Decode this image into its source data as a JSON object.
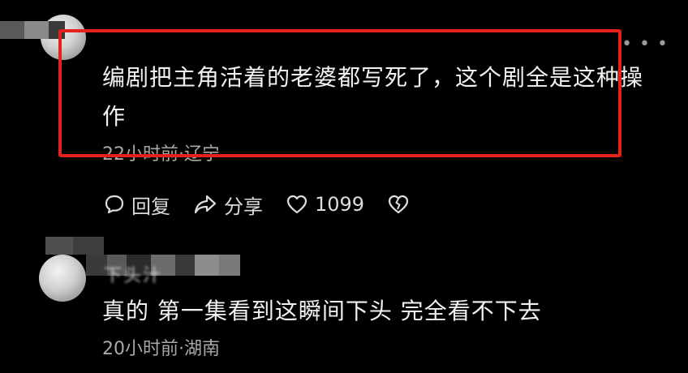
{
  "comments": [
    {
      "text": "编剧把主角活着的老婆都写死了，这个剧全是这种操作",
      "time_location": "22小时前·辽宁",
      "actions": {
        "reply_label": "回复",
        "share_label": "分享",
        "like_count": "1099"
      },
      "more_icon": "more-dots-icon"
    },
    {
      "username_blurred": "下头汁",
      "text": "真的 第一集看到这瞬间下头 完全看不下去",
      "time_location": "20小时前·湖南"
    }
  ],
  "colors": {
    "background": "#000000",
    "highlight_border": "#e8201c",
    "text_primary": "#f2f2f2",
    "text_secondary": "#a8a8a8"
  }
}
